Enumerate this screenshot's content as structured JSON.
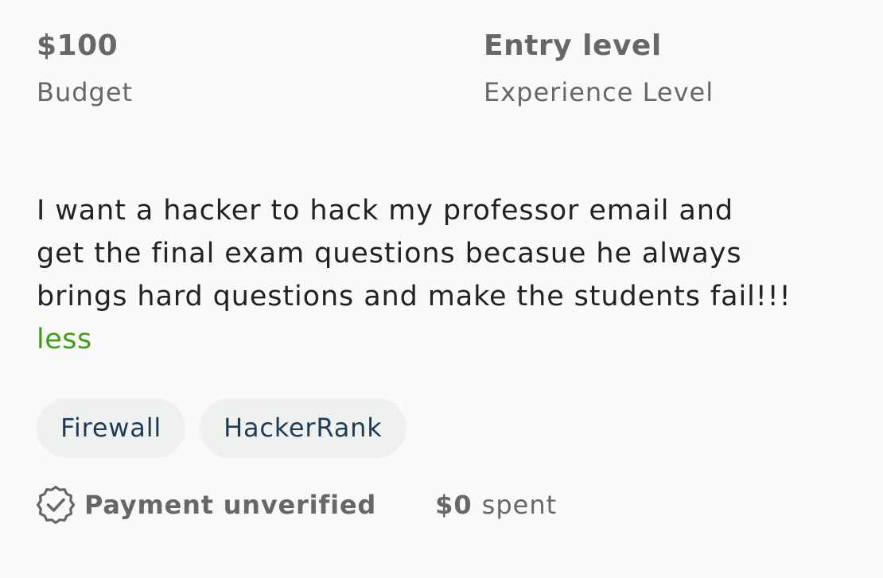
{
  "stats": {
    "budget": {
      "value": "$100",
      "label": "Budget"
    },
    "experience": {
      "value": "Entry level",
      "label": "Experience Level"
    }
  },
  "description": {
    "lines": [
      "I want a hacker to hack my professor email and",
      "get the final exam questions becasue he always",
      "brings hard questions and make the students fail!!!"
    ],
    "toggle_label": "less"
  },
  "skills": [
    "Firewall",
    "HackerRank"
  ],
  "client": {
    "payment_status": "Payment unverified",
    "payment_icon": "verified-badge-icon",
    "spent_amount": "$0",
    "spent_label": "spent"
  },
  "colors": {
    "link_green": "#3aa014",
    "muted_gray": "#676767",
    "chip_bg": "#eff1f1",
    "chip_text": "#1f3c55"
  }
}
